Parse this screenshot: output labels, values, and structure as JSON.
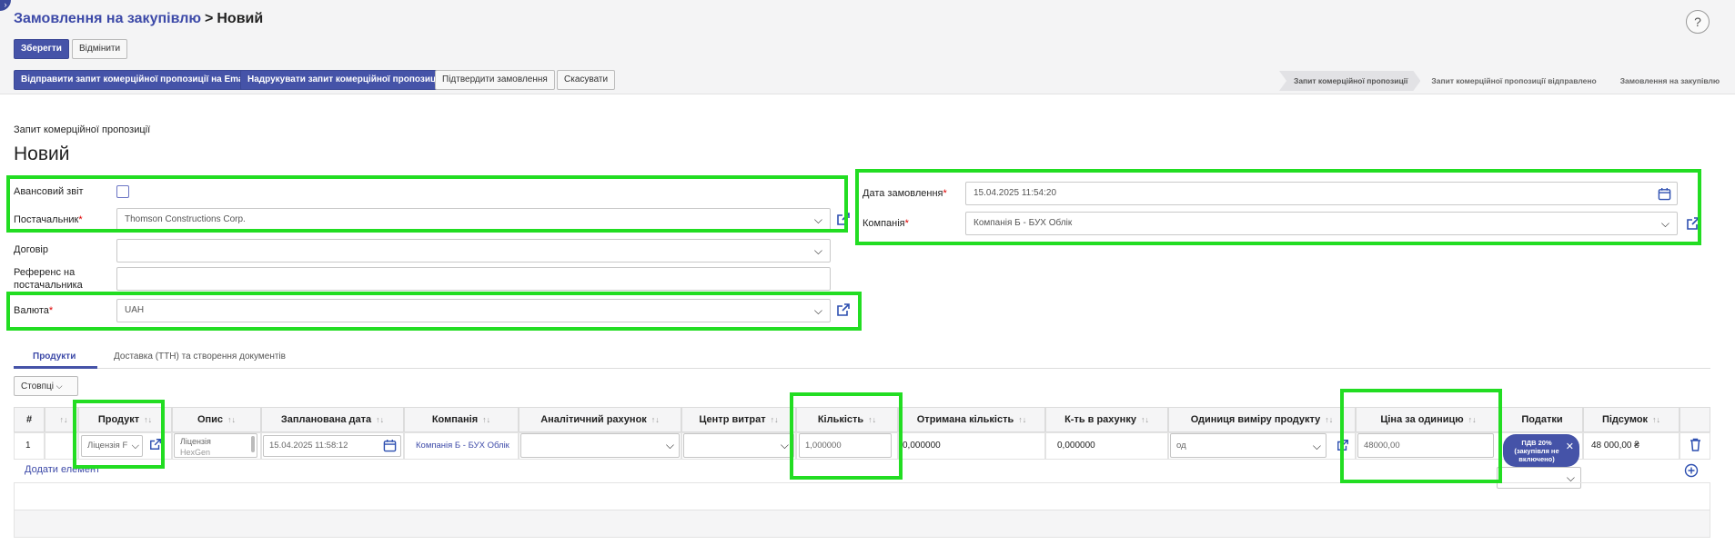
{
  "corner_glyph": "›",
  "breadcrumb": {
    "parent": "Замовлення на закупівлю",
    "separator": ">",
    "current": "Новий"
  },
  "help": "?",
  "buttons": {
    "save": "Зберегти",
    "discard": "Відмінити",
    "send_email": "Відправити запит комерційної пропозиції на Email",
    "print": "Надрукувати запит комерційної пропозиції",
    "confirm": "Підтвердити замовлення",
    "cancel": "Скасувати"
  },
  "status_steps": [
    "Запит комерційної пропозиції",
    "Запит комерційної пропозиції відправлено",
    "Замовлення на закупівлю"
  ],
  "form": {
    "subtitle": "Запит комерційної пропозиції",
    "title": "Новий",
    "advance_report_label": "Авансовий звіт",
    "supplier_label": "Постачальник",
    "supplier_value": "Thomson Constructions Corp.",
    "contract_label": "Договір",
    "contract_value": "",
    "ref_label_1": "Референс на",
    "ref_label_2": "постачальника",
    "ref_value": "",
    "currency_label": "Валюта",
    "currency_value": "UAH",
    "order_date_label": "Дата замовлення",
    "order_date_value": "15.04.2025 11:54:20",
    "company_label": "Компанія",
    "company_value": "Компанія Б - БУХ Облік",
    "required_mark": "*"
  },
  "tabs": {
    "products": "Продукти",
    "delivery": "Доставка (ТТН) та створення документів"
  },
  "columns_button": "Стовпці",
  "table": {
    "headers": {
      "num": "#",
      "product": "Продукт",
      "description": "Опис",
      "planned_date": "Запланована дата",
      "company": "Компанія",
      "analytic": "Аналітичний рахунок",
      "cost_center": "Центр витрат",
      "quantity": "Кількість",
      "received": "Отримана кількість",
      "invoiced": "К-ть в рахунку",
      "uom": "Одиниця виміру продукту",
      "unit_price": "Ціна за одиницю",
      "taxes": "Податки",
      "subtotal": "Підсумок"
    },
    "sort_glyph": "↑↓",
    "row": {
      "num": "1",
      "product": "Ліцензія F",
      "description_1": "Ліцензія",
      "description_2": "HexGen",
      "planned_date": "15.04.2025 11:58:12",
      "company": "Компанія Б - БУХ Облік",
      "quantity": "1,000000",
      "received": "0,000000",
      "invoiced": "0,000000",
      "uom": "од",
      "unit_price": "48000,00",
      "tax_tag_1": "ПДВ 20%",
      "tax_tag_2": "(закупівля не",
      "tax_tag_3": "включено)",
      "subtotal": "48 000,00 ₴"
    },
    "add_item": "Додати елемент"
  }
}
